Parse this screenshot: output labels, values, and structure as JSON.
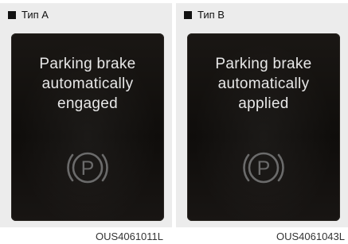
{
  "panels": [
    {
      "type_label": "Тип A",
      "message_lines": [
        "Parking brake",
        "automatically",
        "engaged"
      ],
      "icon": "parking-brake-icon",
      "image_code": "OUS4061011L"
    },
    {
      "type_label": "Тип B",
      "message_lines": [
        "Parking brake",
        "automatically",
        "applied"
      ],
      "icon": "parking-brake-icon",
      "image_code": "OUS4061043L"
    }
  ],
  "colors": {
    "screen_background": "#14110f",
    "message_text": "#e8e8e8",
    "icon_gray": "#6b6b6b",
    "panel_background": "#ececec"
  }
}
